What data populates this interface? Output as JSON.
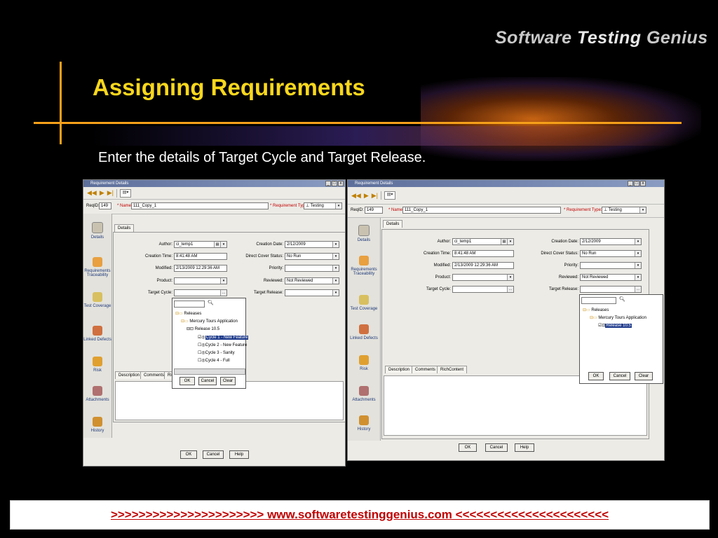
{
  "slide": {
    "logo": {
      "software": "Software",
      "testing": "Testing",
      "genius": "Genius"
    },
    "title": "Assigning Requirements",
    "subtitle": "Enter the details of Target Cycle and Target Release.",
    "footer_link": ">>>>>>>>>>>>>>>>>>>>>>  www.softwaretestinggenius.com  <<<<<<<<<<<<<<<<<<<<<<"
  },
  "left_window": {
    "title": "Requirement Details",
    "reqid_label": "ReqID:",
    "reqid": "149",
    "name_label": "* Name:",
    "name": "111_Copy_1",
    "reqtype_label": "* Requirement Type:",
    "reqtype": "Testing",
    "tab": "Details",
    "author_label": "Author:",
    "author": "ci_temp1",
    "creation_time_label": "Creation Time:",
    "creation_time": "8:41:48 AM",
    "modified_label": "Modified:",
    "modified": "2/13/2009 12:29:36 AM",
    "product_label": "Product:",
    "target_cycle_label": "Target Cycle:",
    "creation_date_label": "Creation Date:",
    "creation_date": "2/12/2009",
    "direct_cover_label": "Direct Cover Status:",
    "direct_cover": "No Run",
    "priority_label": "Priority:",
    "reviewed_label": "Reviewed:",
    "reviewed": "Not Reviewed",
    "target_release_label": "Target Release:",
    "sidebar": [
      "Details",
      "Requirements Traceability",
      "Test Coverage",
      "Linked Defects",
      "Risk",
      "Attachments",
      "History"
    ],
    "bottom_tabs": [
      "Description",
      "Comments",
      "RichContent"
    ],
    "tree": {
      "root": "Releases",
      "app": "Mercury Tours Application",
      "release": "Release 10.5",
      "cycles": [
        "Cycle 1 - New Feature",
        "Cycle 2 - New Feature",
        "Cycle 3 - Sanity",
        "Cycle 4 - Full"
      ]
    },
    "popup_buttons": [
      "OK",
      "Cancel",
      "Clear"
    ],
    "buttons": [
      "OK",
      "Cancel",
      "Help"
    ]
  },
  "right_window": {
    "title": "Requirement Details",
    "reqid_label": "ReqID:",
    "reqid": "149",
    "name_label": "* Name:",
    "name": "111_Copy_1",
    "reqtype_label": "* Requirement Type:",
    "reqtype": "Testing",
    "tab": "Details",
    "author_label": "Author:",
    "author": "ci_temp1",
    "creation_time_label": "Creation Time:",
    "creation_time": "8:41:48 AM",
    "modified_label": "Modified:",
    "modified": "2/13/2009 12:29:36 AM",
    "product_label": "Product:",
    "target_cycle_label": "Target Cycle:",
    "creation_date_label": "Creation Date:",
    "creation_date": "2/12/2009",
    "direct_cover_label": "Direct Cover Status:",
    "direct_cover": "No Run",
    "priority_label": "Priority:",
    "reviewed_label": "Reviewed:",
    "reviewed": "Not Reviewed",
    "target_release_label": "Target Release:",
    "sidebar": [
      "Details",
      "Requirements Traceability",
      "Test Coverage",
      "Linked Defects",
      "Risk",
      "Attachments",
      "History"
    ],
    "bottom_tabs": [
      "Description",
      "Comments",
      "RichContent"
    ],
    "tree": {
      "root": "Releases",
      "app": "Mercury Tours Application",
      "release": "Release 10.5"
    },
    "popup_buttons": [
      "OK",
      "Cancel",
      "Clear"
    ],
    "buttons": [
      "OK",
      "Cancel",
      "Help"
    ]
  },
  "colors": {
    "title": "#f9d71c",
    "accent_line": "#f5a01a",
    "footer_text": "#c00000",
    "selection": "#203c8c"
  }
}
